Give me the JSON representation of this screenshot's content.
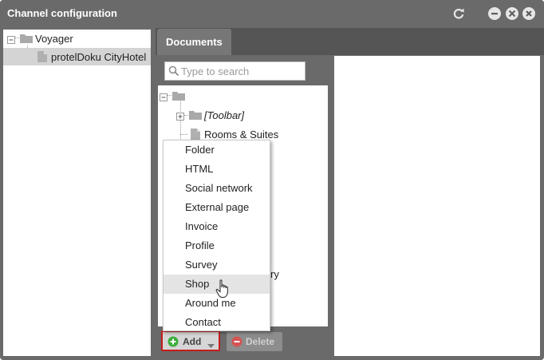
{
  "window": {
    "title": "Channel configuration",
    "title_buttons": {
      "refresh_icon": "refresh-icon",
      "minimize_icon": "minimize-icon",
      "maximize_icon": "maximize-icon",
      "close_icon": "close-icon"
    }
  },
  "left_tree": {
    "items": [
      {
        "label": "Voyager",
        "icon": "folder-icon"
      },
      {
        "label": "protelDoku CityHotel",
        "icon": "document-icon",
        "selected": true
      }
    ]
  },
  "tabs": [
    {
      "label": "Documents",
      "active": true
    }
  ],
  "search": {
    "placeholder": "Type to search"
  },
  "doc_tree": {
    "items": [
      {
        "label": "",
        "icon": "folder-icon"
      },
      {
        "label": "[Toolbar]",
        "icon": "folder-icon"
      },
      {
        "label": "Rooms & Suites",
        "icon": "document-icon"
      }
    ],
    "partial_text": "ry"
  },
  "add_menu": {
    "items": [
      "Folder",
      "HTML",
      "Social network",
      "External page",
      "Invoice",
      "Profile",
      "Survey",
      "Shop",
      "Around me",
      "Contact"
    ],
    "hovered": "Shop"
  },
  "buttons": {
    "add_label": "Add",
    "delete_label": "Delete"
  },
  "colors": {
    "window_bg": "#6a6a6a",
    "selection": "#d4d4d4",
    "menu_hover": "#e4e4e4",
    "add_highlight_border": "#c71d1d",
    "add_icon_green": "#3cae3c",
    "delete_icon_red": "#d45454"
  }
}
